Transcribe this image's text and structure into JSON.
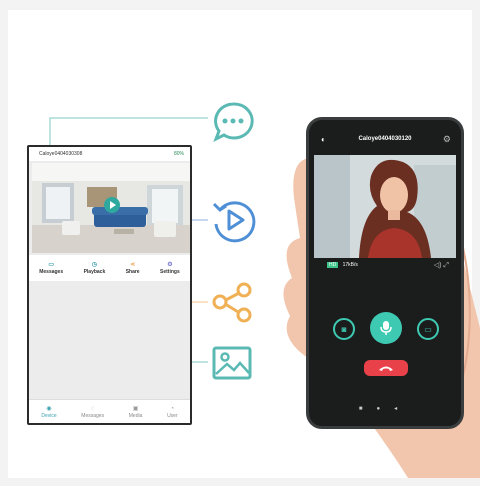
{
  "app_phone": {
    "status": {
      "device_name": "Caloye0404030308",
      "battery": "80%"
    },
    "menu": [
      {
        "label": "Messages",
        "icon": "message-icon"
      },
      {
        "label": "Playback",
        "icon": "playback-icon"
      },
      {
        "label": "Share",
        "icon": "share-icon"
      },
      {
        "label": "Settings",
        "icon": "settings-icon"
      }
    ],
    "nav": [
      {
        "label": "Device",
        "icon": "device-icon",
        "active": true
      },
      {
        "label": "Messages",
        "icon": "messages-icon",
        "active": false
      },
      {
        "label": "Media",
        "icon": "media-icon",
        "active": false
      },
      {
        "label": "User",
        "icon": "user-icon",
        "active": false
      }
    ]
  },
  "feature_icons": [
    {
      "name": "chat-bubble-icon",
      "color": "#5bb9b4"
    },
    {
      "name": "playback-icon",
      "color": "#4f8fd6"
    },
    {
      "name": "share-icon",
      "color": "#f0b055"
    },
    {
      "name": "image-icon",
      "color": "#5bb9b4"
    }
  ],
  "call_phone": {
    "title": "Caloye0404030120",
    "quality": "HD",
    "speed": "17kB/s",
    "buttons": [
      "camera-icon",
      "microphone-icon",
      "video-icon",
      "hangup-icon"
    ],
    "colors": {
      "accent": "#3ec9b2",
      "hangup": "#e8414a",
      "screen": "#1b1d1d"
    }
  }
}
